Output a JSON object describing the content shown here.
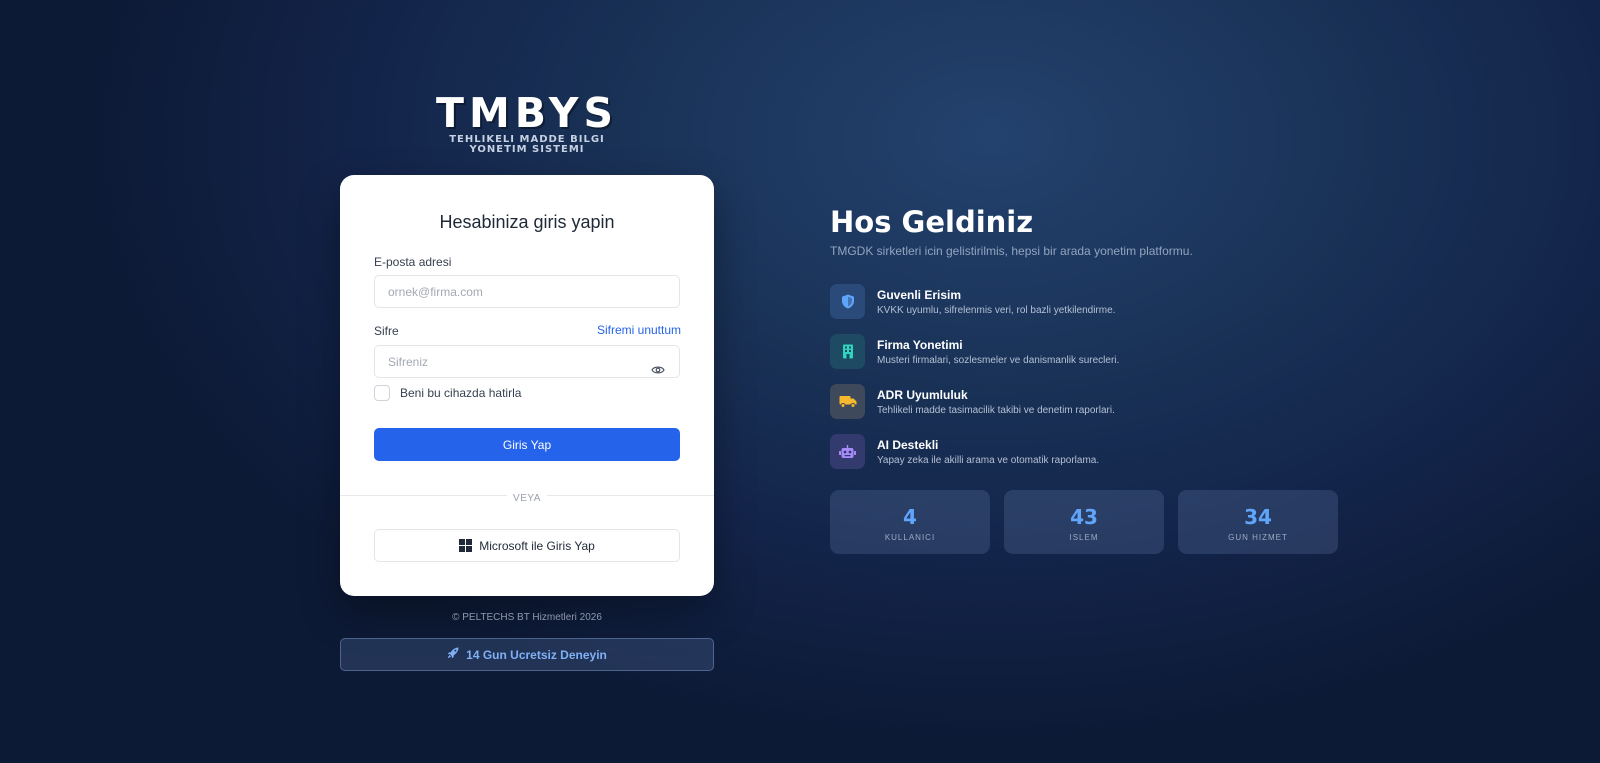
{
  "brand": {
    "title": "TMBYS",
    "subtitle_line1": "TEHLIKELI MADDE BILGI",
    "subtitle_line2": "YONETIM SISTEMI"
  },
  "login": {
    "heading": "Hesabiniza giris yapin",
    "email_label": "E-posta adresi",
    "email_placeholder": "ornek@firma.com",
    "password_label": "Sifre",
    "forgot_link": "Sifremi unuttum",
    "password_placeholder": "Sifreniz",
    "remember_label": "Beni bu cihazda hatirla",
    "submit_label": "Giris Yap",
    "divider_text": "VEYA",
    "microsoft_label": "Microsoft ile Giris Yap"
  },
  "footer": {
    "copyright": "© PELTECHS BT Hizmetleri 2026",
    "trial_label": "14 Gun Ucretsiz Deneyin"
  },
  "welcome": {
    "title": "Hos Geldiniz",
    "subtitle": "TMGDK sirketleri icin gelistirilmis, hepsi bir arada yonetim platformu."
  },
  "features": [
    {
      "icon": "shield-icon",
      "title": "Guvenli Erisim",
      "desc": "KVKK uyumlu, sifrelenmis veri, rol bazli yetkilendirme.",
      "color": "#60a5fa",
      "bg": "#2a4a7a"
    },
    {
      "icon": "building-icon",
      "title": "Firma Yonetimi",
      "desc": "Musteri firmalari, sozlesmeler ve danismanlik surecleri.",
      "color": "#2dd4bf",
      "bg": "#1f4a63"
    },
    {
      "icon": "truck-icon",
      "title": "ADR Uyumluluk",
      "desc": "Tehlikeli madde tasimacilik takibi ve denetim raporlari.",
      "color": "#f5b82e",
      "bg": "#3e4a5c"
    },
    {
      "icon": "robot-icon",
      "title": "AI Destekli",
      "desc": "Yapay zeka ile akilli arama ve otomatik raporlama.",
      "color": "#a78bfa",
      "bg": "#323a6e"
    }
  ],
  "stats": [
    {
      "value": "4",
      "label": "KULLANICI"
    },
    {
      "value": "43",
      "label": "ISLEM"
    },
    {
      "value": "34",
      "label": "GUN HIZMET"
    }
  ],
  "colors": {
    "accent": "#2563eb",
    "stat_value": "#60a5fa",
    "trial_text": "#7fb0f5"
  }
}
